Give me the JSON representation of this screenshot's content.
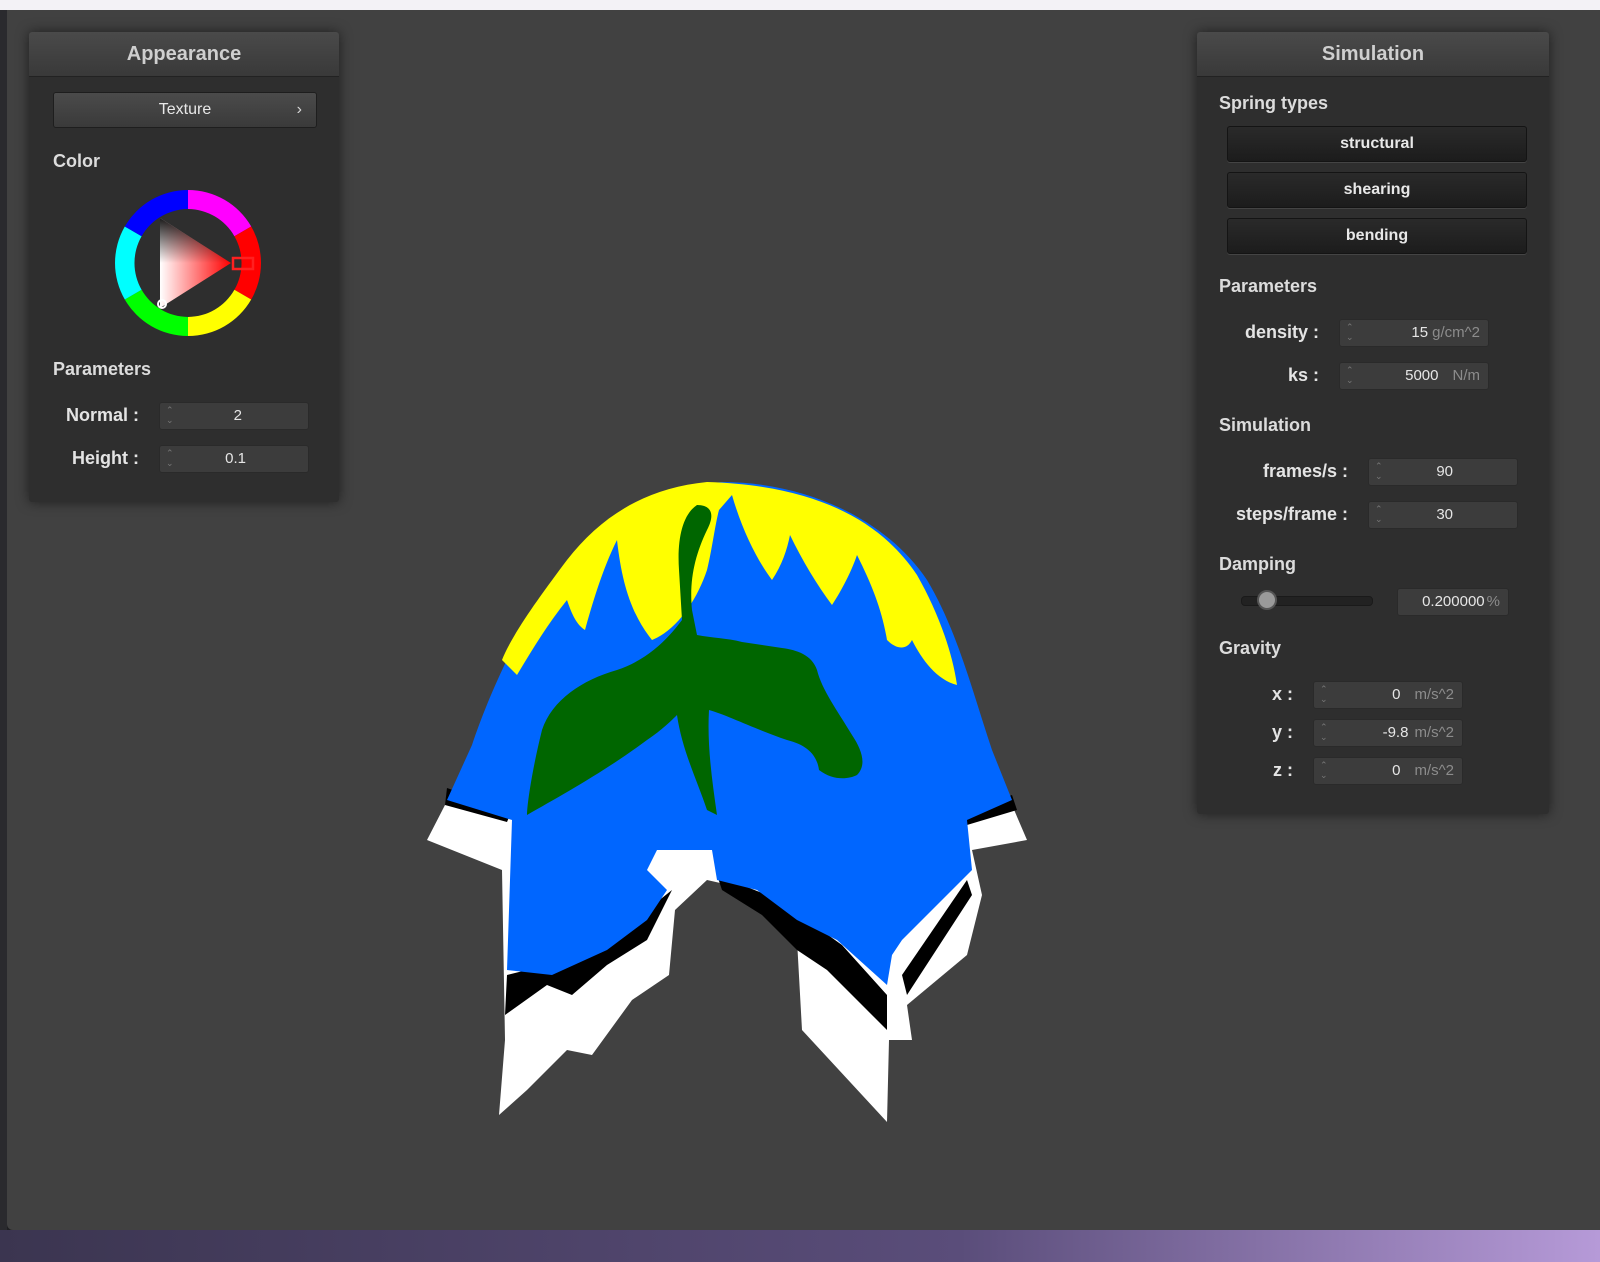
{
  "appearance": {
    "title": "Appearance",
    "texture_button": "Texture",
    "texture_chevron": "›",
    "color_label": "Color",
    "selected_color": "#ff0000",
    "parameters_label": "Parameters",
    "normal": {
      "label": "Normal :",
      "value": "2"
    },
    "height": {
      "label": "Height :",
      "value": "0.1"
    }
  },
  "simulation": {
    "title": "Simulation",
    "spring_types_label": "Spring types",
    "spring_buttons": [
      "structural",
      "shearing",
      "bending"
    ],
    "parameters_label": "Parameters",
    "density": {
      "label": "density :",
      "value": "15",
      "unit": "g/cm^2"
    },
    "ks": {
      "label": "ks :",
      "value": "5000",
      "unit": "N/m"
    },
    "simulation_label": "Simulation",
    "frames_per_s": {
      "label": "frames/s :",
      "value": "90"
    },
    "steps_per_frame": {
      "label": "steps/frame :",
      "value": "30"
    },
    "damping_label": "Damping",
    "damping": {
      "value": "0.200000",
      "unit": "%",
      "slider_fraction": 0.2
    },
    "gravity_label": "Gravity",
    "gravity": [
      {
        "label": "x :",
        "value": "0",
        "unit": "m/s^2"
      },
      {
        "label": "y :",
        "value": "-9.8",
        "unit": "m/s^2"
      },
      {
        "label": "z :",
        "value": "0",
        "unit": "m/s^2"
      }
    ]
  },
  "colors": {
    "viewport_bg": "#414141",
    "cloth_blue": "#0066ff",
    "cloth_yellow": "#ffff00",
    "cloth_green": "#006600",
    "cloth_white": "#ffffff"
  }
}
